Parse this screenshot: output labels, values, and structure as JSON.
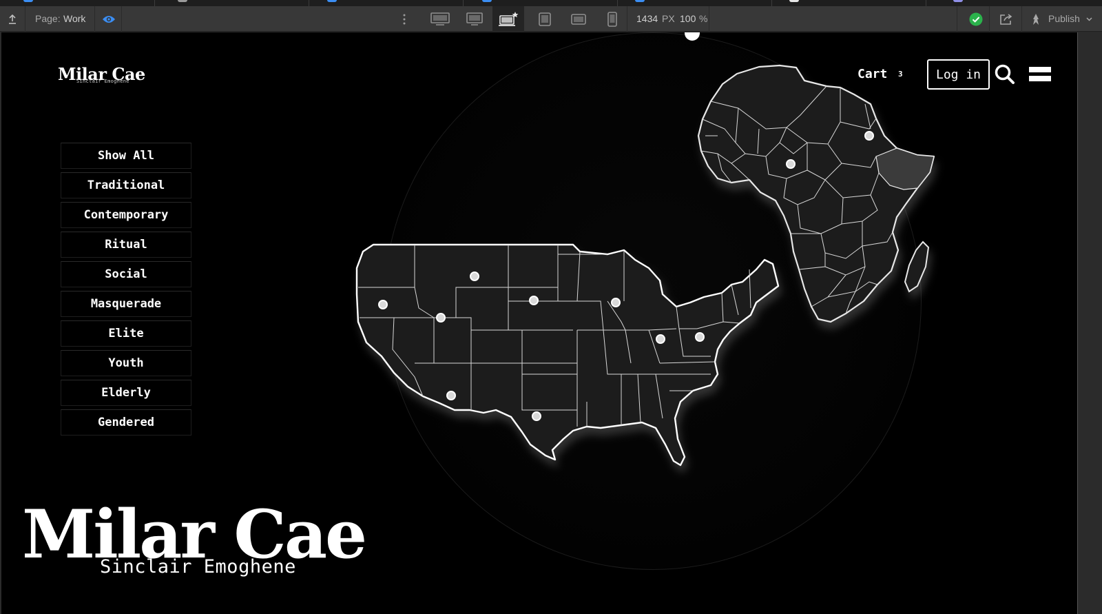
{
  "toolbar": {
    "page_label": "Page:",
    "page_name": "Work",
    "canvas_width": "1434",
    "canvas_width_unit": "PX",
    "zoom": "100",
    "zoom_unit": "%",
    "publish_label": "Publish"
  },
  "site": {
    "logo_word": "Milar Cae",
    "logo_sub": "Sinclair Emoghene",
    "nav": {
      "cart_label": "Cart",
      "cart_count": "3",
      "login_label": "Log in"
    },
    "filters": [
      "Show All",
      "Traditional",
      "Contemporary",
      "Ritual",
      "Social",
      "Masquerade",
      "Elite",
      "Youth",
      "Elderly",
      "Gendered"
    ],
    "hero": {
      "title": "Milar Cae",
      "subtitle": "Sinclair Emoghene"
    }
  },
  "colors": {
    "canvas_bg": "#000000",
    "map_fill": "#1e1e1e",
    "map_stroke": "#e8e8e8",
    "publish_ok": "#2bb24c",
    "accent_blue": "#3b8ef3"
  },
  "icons": {
    "upload": "upload-icon",
    "preview": "eye-icon",
    "more": "more-vertical-icon",
    "status": "check-circle-icon",
    "share": "share-icon",
    "publish": "rocket-icon",
    "search": "search-icon",
    "menu": "hamburger-menu-icon"
  }
}
